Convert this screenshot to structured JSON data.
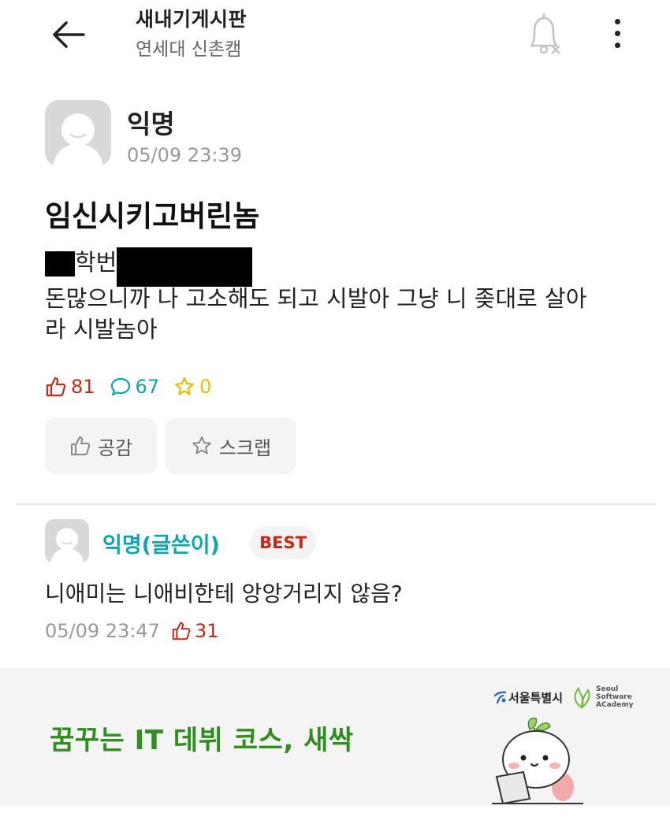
{
  "header": {
    "board_title": "새내기게시판",
    "school_name": "연세대 신촌캠",
    "back_icon": "arrow-left-icon",
    "bell_icon": "bell-off-icon",
    "more_icon": "more-vertical-icon"
  },
  "post": {
    "author": "익명",
    "time": "05/09 23:39",
    "title": "임신시키고버린놈",
    "body_line1_word": "학번",
    "body_line2": "돈많으니까 나 고소해도 되고 시발아 그냥 니 좆대로 살아",
    "body_line3": "라 시발놈아",
    "likes": "81",
    "comments": "67",
    "scraps": "0",
    "like_button": "공감",
    "scrap_button": "스크랩"
  },
  "comment": {
    "author": "익명(글쓴이)",
    "badge": "BEST",
    "text": "니애미는 니애비한테 앙앙거리지 않음?",
    "time": "05/09 23:47",
    "likes": "31"
  },
  "ad": {
    "headline": "꿈꾸는 IT 데뷔 코스, 새싹",
    "seoul_logo": "서울특별시",
    "academy_logo_lines": [
      "Seoul",
      "Software",
      "ACademy"
    ]
  },
  "colors": {
    "like": "#c62917",
    "comment": "#0ca5b0",
    "scrap": "#f2b900",
    "ad_green": "#2f8f1e"
  }
}
